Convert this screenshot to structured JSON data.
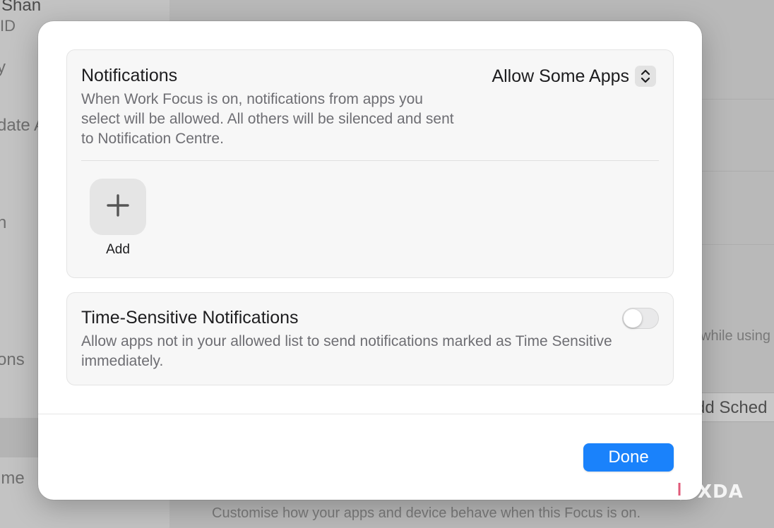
{
  "background": {
    "sidebar_fragments": [
      "Shan",
      "ID",
      "y",
      "date A",
      "n",
      "ons",
      "ime"
    ],
    "main_fragments": [
      "while using",
      "dd Sched"
    ],
    "footer_text": "Customise how your apps and device behave when this Focus is on."
  },
  "dialog": {
    "notifications": {
      "title": "Notifications",
      "description": "When Work Focus is on, notifications from apps you select will be allowed. All others will be silenced and sent to Notification Centre.",
      "popup_value": "Allow Some Apps",
      "add_label": "Add"
    },
    "time_sensitive": {
      "title": "Time-Sensitive Notifications",
      "description": "Allow apps not in your allowed list to send notifications marked as Time Sensitive immediately.",
      "enabled": false
    },
    "done_label": "Done"
  },
  "watermark": "XDA",
  "icons": {
    "popup": "chevron-up-down-icon",
    "add": "plus-icon",
    "watermark": "xda-logo-icon"
  },
  "colors": {
    "accent": "#1a82fb",
    "dim_background": "#bcbcbc",
    "card_background": "#f7f7f7"
  }
}
